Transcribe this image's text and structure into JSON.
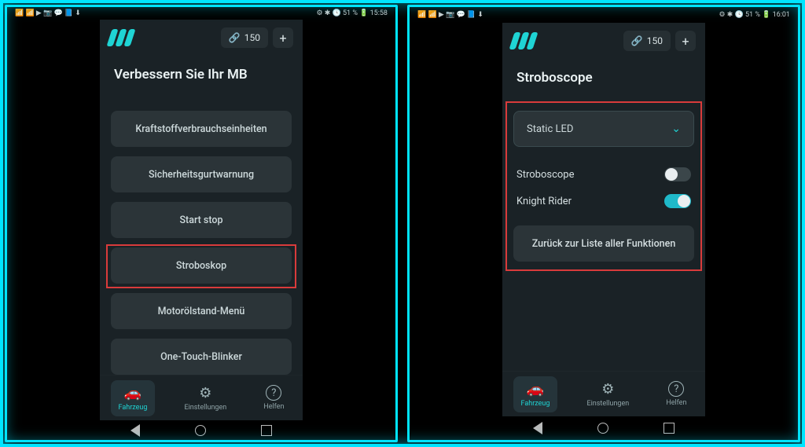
{
  "status": {
    "left": "📶 📶 ▶ 📷 💬 📘 ⬇",
    "right1": "⚙ ✱ 🕓 51 % 🔋 15:58",
    "right2": "⚙ ✱ 🕓 51 % 🔋 16:01"
  },
  "header": {
    "credits": "150",
    "plus": "+"
  },
  "left": {
    "title": "Verbessern Sie Ihr MB",
    "items": [
      "Kraftstoffverbrauchseinheiten",
      "Sicherheitsgurtwarnung",
      "Start stop",
      "Stroboskop",
      "Motorölstand-Menü",
      "One-Touch-Blinker"
    ]
  },
  "right": {
    "title": "Stroboscope",
    "dropdown": "Static LED",
    "toggles": [
      {
        "label": "Stroboscope",
        "on": false
      },
      {
        "label": "Knight Rider",
        "on": true
      }
    ],
    "back": "Zurück zur Liste aller Funktionen"
  },
  "nav": {
    "items": [
      {
        "label": "Fahrzeug",
        "icon": "🚗"
      },
      {
        "label": "Einstellungen",
        "icon": "⚙"
      },
      {
        "label": "Helfen",
        "icon": "?"
      }
    ]
  }
}
